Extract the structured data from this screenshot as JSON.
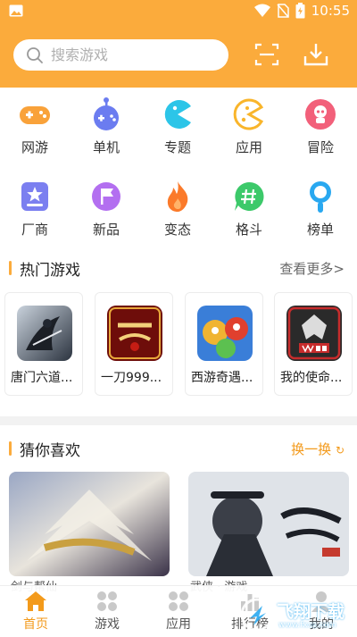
{
  "status_bar": {
    "time": "10:55"
  },
  "header": {
    "search_placeholder": "搜索游戏"
  },
  "categories": [
    {
      "label": "网游",
      "icon": "gamepad-icon",
      "color": "#f9a23a"
    },
    {
      "label": "单机",
      "icon": "joystick-icon",
      "color": "#6b7cf0"
    },
    {
      "label": "专题",
      "icon": "pacman-icon",
      "color": "#2cc5e8"
    },
    {
      "label": "应用",
      "icon": "app-icon",
      "color": "#f9b52b"
    },
    {
      "label": "冒险",
      "icon": "adventure-icon",
      "color": "#f2607a"
    },
    {
      "label": "厂商",
      "icon": "star-badge-icon",
      "color": "#7b7ff0"
    },
    {
      "label": "新品",
      "icon": "flag-icon",
      "color": "#b36ff0"
    },
    {
      "label": "变态",
      "icon": "flame-icon",
      "color": "#fb7a2a"
    },
    {
      "label": "格斗",
      "icon": "hashtag-icon",
      "color": "#3cc96a"
    },
    {
      "label": "榜单",
      "icon": "trophy-person-icon",
      "color": "#29a8f0"
    }
  ],
  "hot_section": {
    "title": "热门游戏",
    "more": "查看更多>"
  },
  "hot_games": [
    {
      "name": "唐门六道..."
    },
    {
      "name": "一刀999..."
    },
    {
      "name": "西游奇遇..."
    },
    {
      "name": "我的使命..."
    }
  ],
  "guess_section": {
    "title": "猜你喜欢",
    "more": "换一换"
  },
  "guess_items": [
    {
      "caption": "剑与帮仙"
    },
    {
      "caption": "武侠 · 游戏"
    }
  ],
  "bottom_nav": [
    {
      "label": "首页",
      "icon": "home-icon",
      "active": true
    },
    {
      "label": "游戏",
      "icon": "grid-icon",
      "active": false
    },
    {
      "label": "应用",
      "icon": "grid-icon",
      "active": false
    },
    {
      "label": "排行榜",
      "icon": "rank-icon",
      "active": false
    },
    {
      "label": "我的",
      "icon": "user-icon",
      "active": false
    }
  ],
  "watermark": {
    "text": "飞翔下载",
    "sub": "www.fxxz.com"
  },
  "colors": {
    "accent": "#fbab3c",
    "accent_text": "#f39a1b"
  }
}
